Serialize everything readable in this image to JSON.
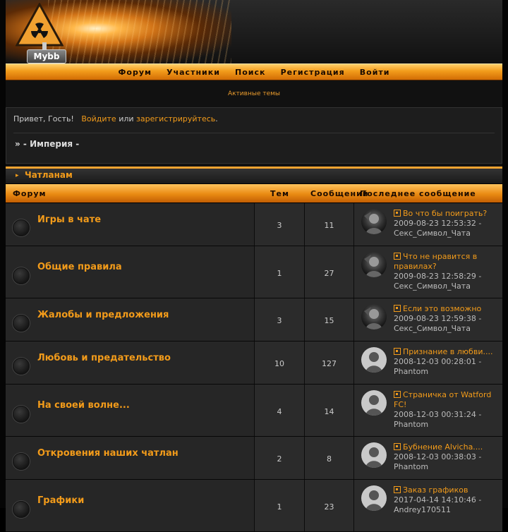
{
  "header": {
    "logo_text": "Mybb"
  },
  "nav": {
    "items": [
      "Форум",
      "Участники",
      "Поиск",
      "Регистрация",
      "Войти"
    ]
  },
  "active_topics": "Активные темы",
  "welcome": {
    "greeting": "Привет, Гость!",
    "login": "Войдите",
    "or": "или",
    "register": "зарегистрируйтесь",
    "dot": ".",
    "breadcrumb": "» - Империя -"
  },
  "category": {
    "title": "Чатланам"
  },
  "columns": {
    "forum": "Форум",
    "topics": "Тем",
    "posts": "Сообщений",
    "last": "Последнее сообщение"
  },
  "forums": [
    {
      "name": "Игры в чате",
      "topics": "3",
      "posts": "11",
      "avatar": "photo",
      "last_title": "Во что бы поиграть?",
      "last_date": "2009-08-23 12:53:32 -",
      "last_user": "Секс_Символ_Чата"
    },
    {
      "name": "Общие правила",
      "topics": "1",
      "posts": "27",
      "avatar": "photo",
      "last_title": "Что не нравится в правилах?",
      "last_date": "2009-08-23 12:58:29 -",
      "last_user": "Секс_Символ_Чата"
    },
    {
      "name": "Жалобы и предложения",
      "topics": "3",
      "posts": "15",
      "avatar": "photo",
      "last_title": "Если это возможно",
      "last_date": "2009-08-23 12:59:38 -",
      "last_user": "Секс_Символ_Чата"
    },
    {
      "name": "Любовь и предательство",
      "topics": "10",
      "posts": "127",
      "avatar": "default",
      "last_title": "Признание в любви....",
      "last_date": "2008-12-03 00:28:01 -",
      "last_user": "Phantom"
    },
    {
      "name": "На своей волне...",
      "topics": "4",
      "posts": "14",
      "avatar": "default",
      "last_title": "Страничка от Watford FC!",
      "last_date": "2008-12-03 00:31:24 -",
      "last_user": "Phantom"
    },
    {
      "name": "Откровения наших чатлан",
      "topics": "2",
      "posts": "8",
      "avatar": "default",
      "last_title": "Бубнение Alvicha....",
      "last_date": "2008-12-03 00:38:03 -",
      "last_user": "Phantom"
    },
    {
      "name": "Графики",
      "topics": "1",
      "posts": "23",
      "avatar": "default",
      "last_title": "Заказ графиков",
      "last_date": "2017-04-14 14:10:46 -",
      "last_user": "Andrey170511"
    }
  ]
}
